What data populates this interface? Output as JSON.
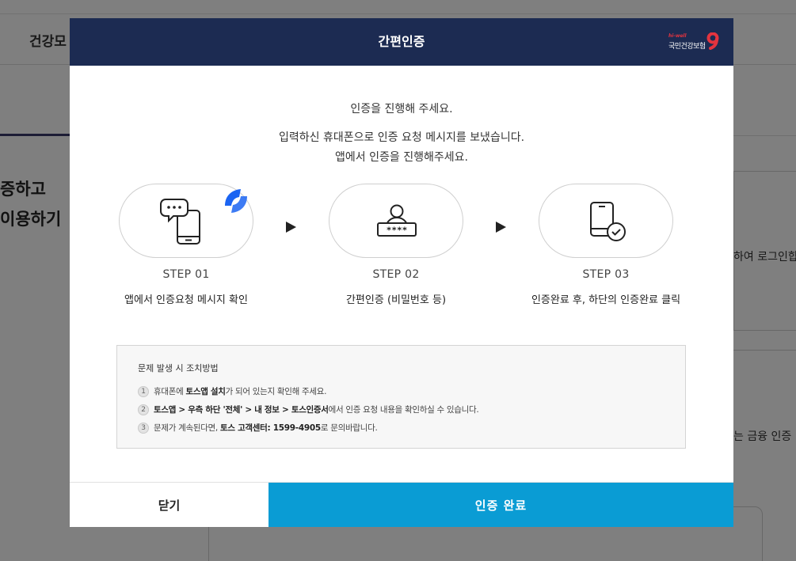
{
  "background": {
    "nav_text": "건강모",
    "left_heading_1": "증하고",
    "left_heading_2": "이용하기",
    "right_text_1": "하여 로그인합",
    "right_text_2": "는 금융 인증"
  },
  "modal": {
    "title": "간편인증",
    "brand_small": "hi-well",
    "brand_name": "국민건강보험"
  },
  "intro": {
    "line1": "인증을 진행해 주세요.",
    "line2": "입력하신 휴대폰으로 인증 요청 메시지를 보냈습니다.",
    "line3": "앱에서 인증을 진행해주세요."
  },
  "steps": [
    {
      "label": "STEP 01",
      "desc": "앱에서 인증요청 메시지 확인",
      "icon": "phone-message-icon"
    },
    {
      "label": "STEP 02",
      "desc": "간편인증 (비밀번호 등)",
      "icon": "user-password-icon"
    },
    {
      "label": "STEP 03",
      "desc": "인증완료 후, 하단의 인증완료 클릭",
      "icon": "phone-check-icon"
    }
  ],
  "help": {
    "title": "문제 발생 시 조치방법",
    "items": [
      {
        "num": "1",
        "pre": "휴대폰에 ",
        "bold": "토스앱 설치",
        "post": "가 되어 있는지 확인해 주세요."
      },
      {
        "num": "2",
        "pre": "",
        "bold": "토스앱 > 우측 하단 '전체' > 내 정보 > 토스인증서",
        "post": "에서 인증 요청 내용을 확인하실 수 있습니다."
      },
      {
        "num": "3",
        "pre": "문제가 계속된다면, ",
        "bold": "토스 고객센터: 1599-4905",
        "post": "로 문의바랍니다."
      }
    ]
  },
  "buttons": {
    "close": "닫기",
    "done": "인증 완료"
  },
  "colors": {
    "header": "#1c2b52",
    "primary": "#0a9cd4",
    "toss": "#1b64f2"
  }
}
